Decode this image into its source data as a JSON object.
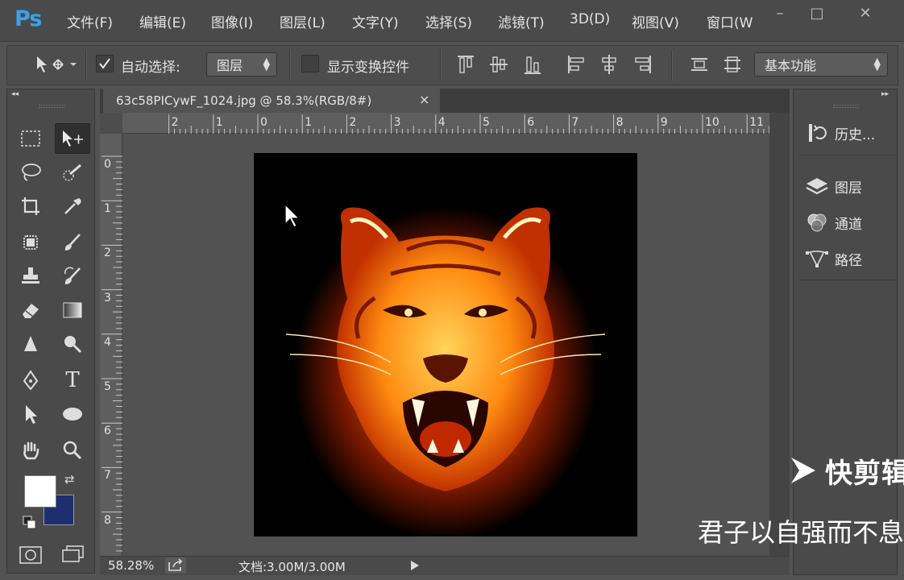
{
  "app": {
    "logo": "Ps"
  },
  "menu": [
    "文件(F)",
    "编辑(E)",
    "图像(I)",
    "图层(L)",
    "文字(Y)",
    "选择(S)",
    "滤镜(T)",
    "3D(D)",
    "视图(V)",
    "窗口(W"
  ],
  "window_controls": {
    "minimize": "–",
    "maximize": "□",
    "close": "✕"
  },
  "options_bar": {
    "auto_select_label": "自动选择:",
    "auto_select_target": "图层",
    "show_transform_label": "显示变换控件",
    "workspace": "基本功能"
  },
  "document": {
    "tab_title": "63c58PICywF_1024.jpg @ 58.3%(RGB/8#)",
    "tab_close": "×",
    "zoom": "58.28%",
    "doc_size": "文档:3.00M/3.00M"
  },
  "rulers": {
    "top": [
      "2",
      "1",
      "0",
      "1",
      "2",
      "3",
      "4",
      "5",
      "6",
      "7",
      "8",
      "9",
      "10",
      "11"
    ],
    "left": [
      "0",
      "1",
      "2",
      "3",
      "4",
      "5",
      "6",
      "7",
      "8"
    ]
  },
  "panels": {
    "history": "历史...",
    "layers": "图层",
    "channels": "通道",
    "paths": "路径"
  },
  "colors": {
    "foreground": "#ffffff",
    "background": "#1e2f70"
  },
  "watermark": {
    "brand": "快剪辑",
    "quote": "君子以自强而不息"
  },
  "icons": [
    "move-tool-icon",
    "marquee-icon",
    "lasso-icon",
    "quick-select-icon",
    "crop-icon",
    "eyedropper-icon",
    "healing-icon",
    "brush-icon",
    "stamp-icon",
    "history-brush-icon",
    "eraser-icon",
    "gradient-icon",
    "sharpen-icon",
    "dodge-icon",
    "pen-icon",
    "type-icon",
    "path-select-icon",
    "ellipse-icon",
    "hand-icon",
    "zoom-icon"
  ]
}
